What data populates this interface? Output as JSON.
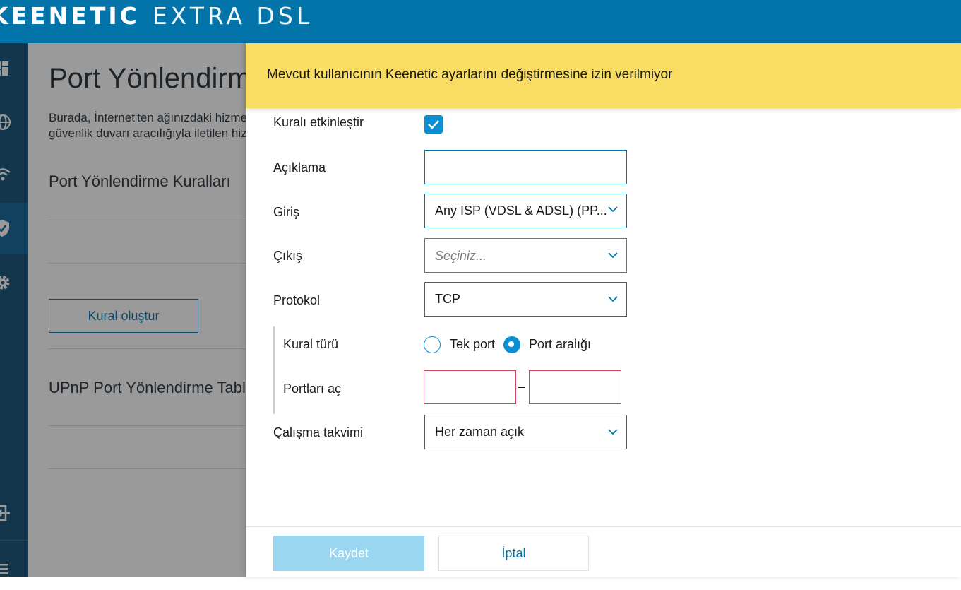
{
  "brand": {
    "part1": "KEENETIC",
    "part2": "EXTRA DSL"
  },
  "sidebar": {
    "icons": [
      "dashboard-icon",
      "globe-icon",
      "wifi-icon",
      "shield-icon",
      "gear-icon",
      "logout-icon",
      "menu-icon"
    ],
    "active": "shield-icon"
  },
  "page": {
    "title": "Port Yönlendirme",
    "desc_line1": "Burada, İnternet'ten ağınızdaki hizmetlere",
    "desc_line2": "güvenlik duvarı aracılığıyla iletilen hiz",
    "rules_title": "Port Yönlendirme Kuralları",
    "create_button": "Kural oluştur",
    "upnp_title": "UPnP Port Yönlendirme Tablosu"
  },
  "panel": {
    "warning": "Mevcut kullanıcının Keenetic ayarlarını değiştirmesine izin verilmiyor",
    "enable_label": "Kuralı etkinleştir",
    "enable_checked": true,
    "description_label": "Açıklama",
    "description_value": "",
    "input_label": "Giriş",
    "input_value": "Any ISP (VDSL & ADSL) (PP...",
    "output_label": "Çıkış",
    "output_placeholder": "Seçiniz...",
    "protocol_label": "Protokol",
    "protocol_value": "TCP",
    "rule_type_label": "Kural türü",
    "rule_type_single": "Tek port",
    "rule_type_range": "Port aralığı",
    "rule_type_selected": "Port aralığı",
    "open_ports_label": "Portları aç",
    "port_from": "",
    "port_to": "",
    "port_separator": "–",
    "schedule_label": "Çalışma takvimi",
    "schedule_value": "Her zaman açık",
    "save_button": "Kaydet",
    "cancel_button": "İptal"
  },
  "colors": {
    "header": "#0274aa",
    "sidebar": "#0b4a72",
    "warning": "#f9dd62",
    "accent": "#0b8fd2",
    "error": "#d0445c",
    "save_disabled": "#9bd6f0"
  }
}
